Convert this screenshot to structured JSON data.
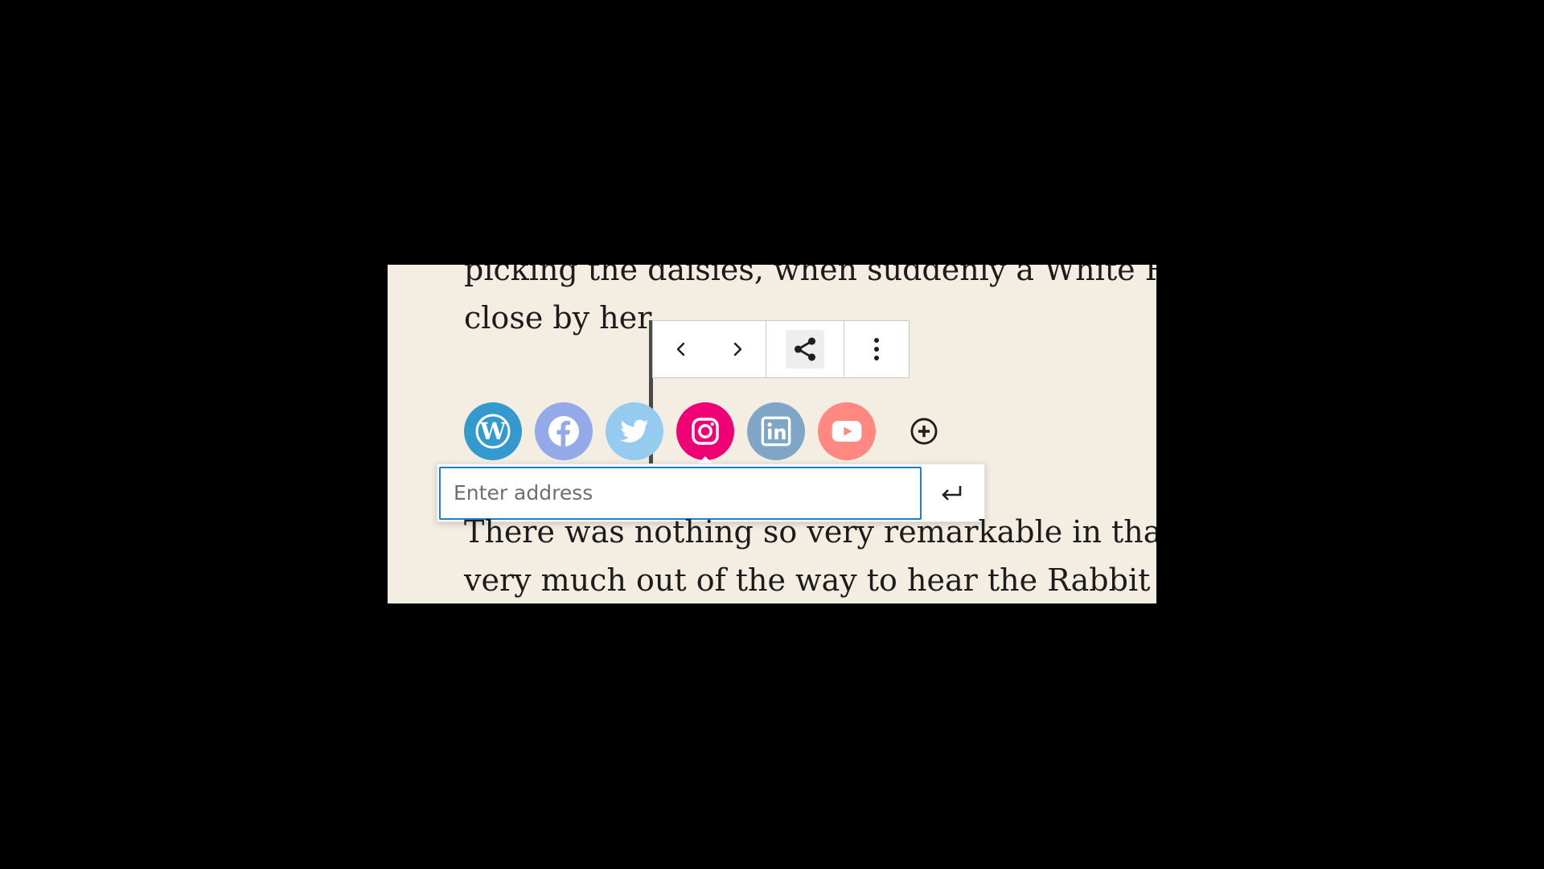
{
  "content": {
    "paragraph_top": "picking the daisies, when suddenly a White Rabbit\nclose by her.",
    "paragraph_bottom": "There was nothing so very remarkable in that; nor\nvery much out of the way to hear the Rabbit say to"
  },
  "toolbar": {
    "buttons": [
      {
        "name": "move-left-button",
        "icon": "chevron-left-icon"
      },
      {
        "name": "move-right-button",
        "icon": "chevron-right-icon"
      },
      {
        "name": "change-block-type-button",
        "icon": "share-icon"
      },
      {
        "name": "more-options-button",
        "icon": "more-vertical-icon"
      }
    ]
  },
  "social_links": [
    {
      "service": "WordPress",
      "icon": "wordpress-icon",
      "color": "#3499cd",
      "active": false
    },
    {
      "service": "Facebook",
      "icon": "facebook-icon",
      "color": "#94a9ea",
      "active": false
    },
    {
      "service": "Twitter",
      "icon": "twitter-icon",
      "color": "#94cbef",
      "active": false
    },
    {
      "service": "Instagram",
      "icon": "instagram-icon",
      "color": "#f00075",
      "active": true
    },
    {
      "service": "LinkedIn",
      "icon": "linkedin-icon",
      "color": "#7fa6c6",
      "active": false
    },
    {
      "service": "YouTube",
      "icon": "youtube-icon",
      "color": "#ff8880",
      "active": false
    }
  ],
  "add_button": {
    "icon": "add-circle-icon"
  },
  "link_popover": {
    "placeholder": "Enter address",
    "value": "",
    "submit_icon": "enter-icon"
  },
  "colors": {
    "page_background": "#f4eee2",
    "letterbox": "#000000",
    "input_focus": "#1e7ec7"
  }
}
